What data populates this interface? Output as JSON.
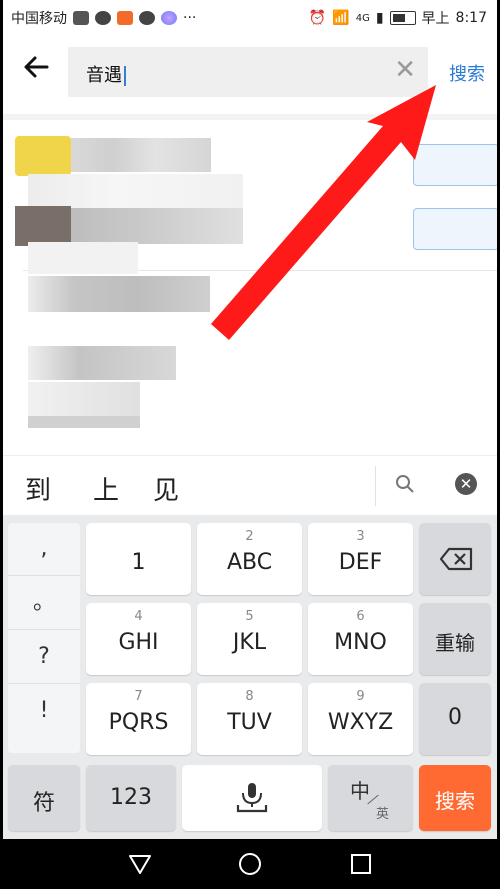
{
  "status_bar": {
    "carrier": "中国移动",
    "network": "4G",
    "time_prefix": "早上",
    "time": "8:17"
  },
  "search": {
    "back_icon": "arrow-left-icon",
    "query": "音遇",
    "clear_icon": "close-icon",
    "submit_label": "搜索"
  },
  "candidates": {
    "words": [
      "到",
      "上",
      "见"
    ],
    "search_icon": "search-icon",
    "close_icon": "close-circle-icon"
  },
  "keyboard": {
    "punct": [
      ",",
      "。",
      "?",
      "!"
    ],
    "keys": [
      {
        "num": "",
        "label": "1"
      },
      {
        "num": "2",
        "label": "ABC"
      },
      {
        "num": "3",
        "label": "DEF"
      },
      {
        "num": "4",
        "label": "GHI"
      },
      {
        "num": "5",
        "label": "JKL"
      },
      {
        "num": "6",
        "label": "MNO"
      },
      {
        "num": "7",
        "label": "PQRS"
      },
      {
        "num": "8",
        "label": "TUV"
      },
      {
        "num": "9",
        "label": "WXYZ"
      }
    ],
    "backspace_icon": "backspace-icon",
    "retype_label": "重输",
    "zero_label": "0",
    "symbol_label": "符",
    "num_label": "123",
    "mic_icon": "microphone-icon",
    "lang_main": "中",
    "lang_sub": "英",
    "search_label": "搜索"
  },
  "nav": {
    "back_icon": "triangle-back-icon",
    "home_icon": "circle-home-icon",
    "recent_icon": "square-recent-icon"
  },
  "colors": {
    "accent_link": "#2a7ad8",
    "search_key": "#ff6a33",
    "arrow": "#ff1a1a"
  }
}
